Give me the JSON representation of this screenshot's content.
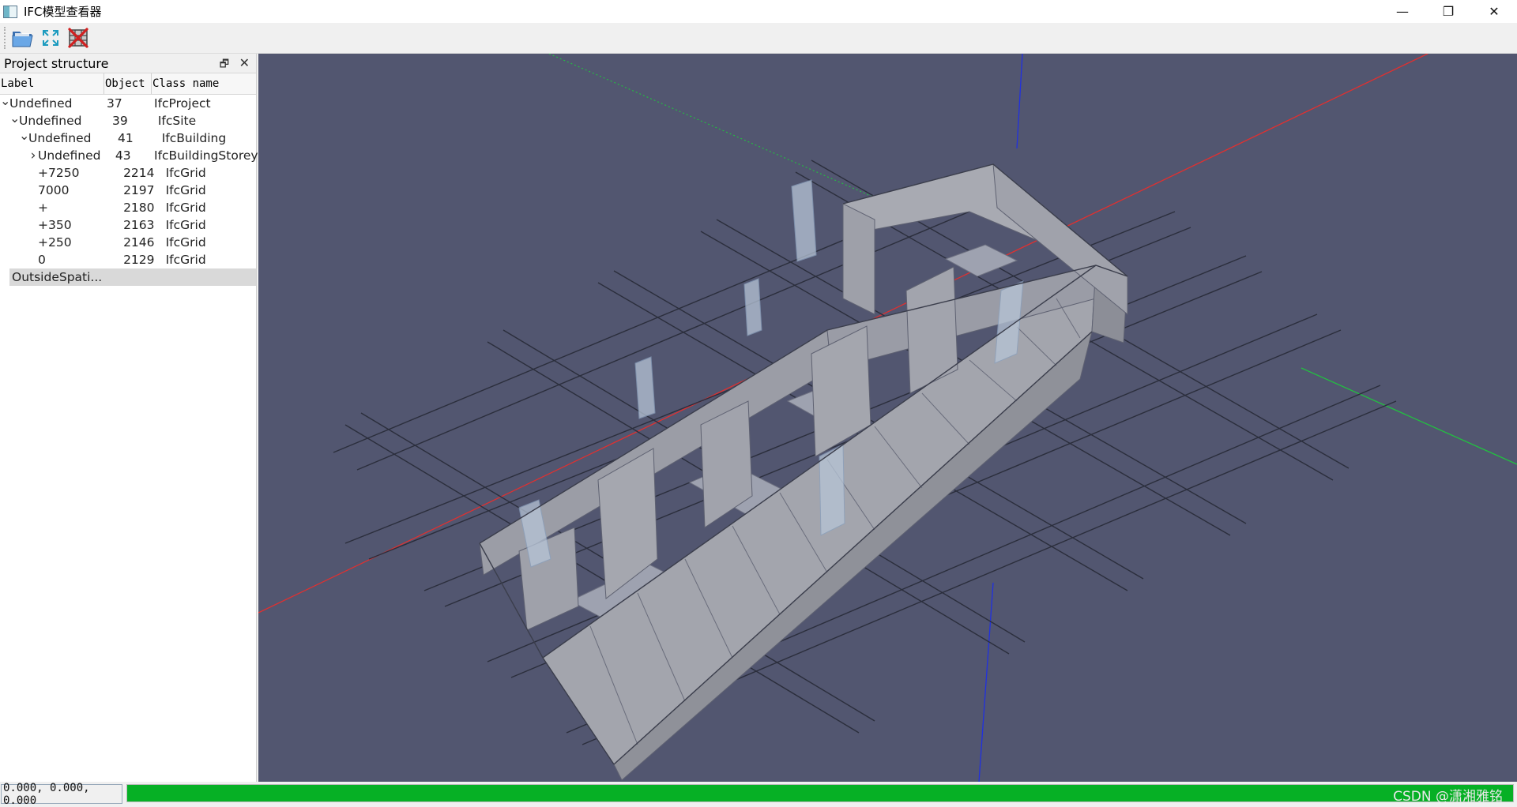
{
  "window": {
    "title": "IFC模型查看器",
    "minimize_glyph": "—",
    "maximize_glyph": "❐",
    "close_glyph": "✕"
  },
  "toolbar": {
    "buttons": [
      {
        "name": "open-folder-icon"
      },
      {
        "name": "fit-view-icon"
      },
      {
        "name": "clear-model-icon"
      }
    ]
  },
  "panel": {
    "title": "Project structure",
    "float_glyph": "🗗",
    "close_glyph": "✕",
    "columns": [
      "Label",
      "Object",
      "Class name"
    ],
    "rows": [
      {
        "label": "Undefined",
        "object": "37",
        "class_name": "IfcProject",
        "indent": 0,
        "expander": "expanded"
      },
      {
        "label": "Undefined",
        "object": "39",
        "class_name": "IfcSite",
        "indent": 1,
        "expander": "expanded"
      },
      {
        "label": "Undefined",
        "object": "41",
        "class_name": "IfcBuilding",
        "indent": 2,
        "expander": "expanded"
      },
      {
        "label": "Undefined",
        "object": "43",
        "class_name": "IfcBuildingStorey",
        "indent": 3,
        "expander": "collapsed"
      },
      {
        "label": "+7250",
        "object": "2214",
        "class_name": "IfcGrid",
        "indent": 3,
        "expander": "none"
      },
      {
        "label": "7000",
        "object": "2197",
        "class_name": "IfcGrid",
        "indent": 3,
        "expander": "none"
      },
      {
        "label": "+",
        "object": "2180",
        "class_name": "IfcGrid",
        "indent": 3,
        "expander": "none"
      },
      {
        "label": "+350",
        "object": "2163",
        "class_name": "IfcGrid",
        "indent": 3,
        "expander": "none"
      },
      {
        "label": "+250",
        "object": "2146",
        "class_name": "IfcGrid",
        "indent": 3,
        "expander": "none"
      },
      {
        "label": "0",
        "object": "2129",
        "class_name": "IfcGrid",
        "indent": 3,
        "expander": "none"
      }
    ],
    "selected_row": "OutsideSpati..."
  },
  "viewport": {
    "background": "#525670",
    "axis_colors": {
      "x": "#e03030",
      "y": "#22c040",
      "z": "#2030e0"
    }
  },
  "status": {
    "coordinates": "0.000, 0.000, 0.000",
    "progress_fraction": 1.0,
    "progress_color": "#06b025",
    "watermark": "CSDN @潇湘雅铭"
  }
}
